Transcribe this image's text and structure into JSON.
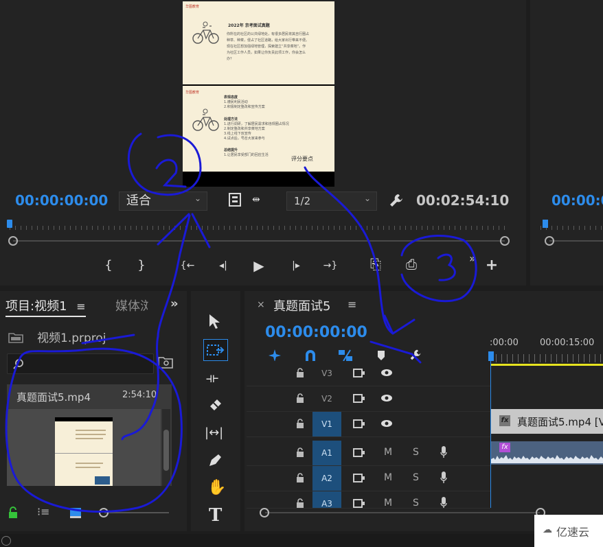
{
  "source_monitor": {
    "timecode_in": "00:00:00:00",
    "fit_label": "适合",
    "resolution": "1/2",
    "duration": "00:02:54:10",
    "preview": {
      "brand": "华图教育",
      "title": "2022年 京考面试真题",
      "question": "你所在的社区的公共绿地处，有很多居民将其自行圈占种草、种菜，侵占了社区道路，给大家出行带来不便。现在社区想加强绿地管理，探索建立“共享菜地”。作为社区工作人员，如果让你负责此项工作，你会怎么办？",
      "sections": [
        {
          "heading": "表现态度",
          "items": [
            "1.遵民利民活动",
            "2.积极制定整改和宣传方案"
          ]
        },
        {
          "heading": "处理方法",
          "items": [
            "1.进行调研，了解居民需求和违规圈占情况",
            "2.制定整改和共享菜地方案",
            "3.线上线下双宣传",
            "4.试点后，号召大家来参与"
          ]
        },
        {
          "heading": "总结提升",
          "items": [
            "1.让居民享受部门的回应生活"
          ]
        }
      ],
      "scoring_label": "评分要点"
    }
  },
  "program_monitor": {
    "timecode": "00:00:0"
  },
  "transport": {
    "mark_in": "{",
    "mark_out": "}",
    "go_in": "{←",
    "step_back": "◂|",
    "play": "▶",
    "step_fwd": "|▸",
    "go_out": "→}",
    "insert": "⎘",
    "overwrite": "⎙",
    "more": "»",
    "add": "+"
  },
  "project_panel": {
    "tab_project": "项目:视频1",
    "tab_media": "媒体浏",
    "menu": "≡",
    "overflow": "»",
    "file_name": "视频1.prproj",
    "search_placeholder": "",
    "clip_name": "真题面试5.mp4",
    "clip_duration": "2:54:10"
  },
  "timeline": {
    "close": "×",
    "sequence_name": "真题面试5",
    "menu": "≡",
    "timecode": "00:00:00:00",
    "ruler_labels": [
      ":00:00",
      "00:00:15:00"
    ],
    "tracks": [
      {
        "name": "V3",
        "kind": "video"
      },
      {
        "name": "V2",
        "kind": "video"
      },
      {
        "name": "V1",
        "kind": "video"
      },
      {
        "name": "A1",
        "kind": "audio",
        "m": "M",
        "s": "S"
      },
      {
        "name": "A2",
        "kind": "audio",
        "m": "M",
        "s": "S"
      },
      {
        "name": "A3",
        "kind": "audio",
        "m": "M",
        "s": "S"
      }
    ],
    "video_clip_label": "真题面试5.mp4 [V",
    "fx_label": "fx"
  },
  "watermark": "亿速云",
  "colors": {
    "timecode_blue": "#2d8ceb",
    "track_selected": "#1d4f7c",
    "annotation": "#1a1ad6",
    "playhead_yellow": "#e6e31f"
  }
}
